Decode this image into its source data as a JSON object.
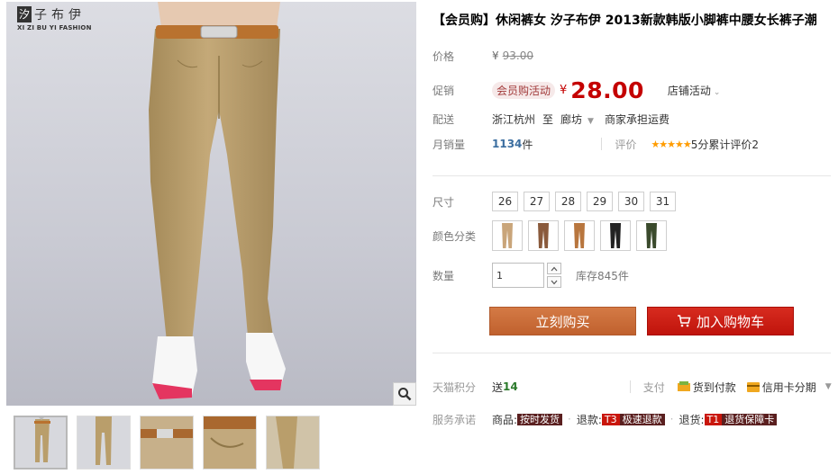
{
  "gallery": {
    "brand_mark": "汐",
    "brand_name": "子布伊",
    "brand_sub": "XI ZI BU YI FASHION",
    "zoom_icon": "magnifier-icon",
    "thumbnails": [
      {
        "pant_color": "#b99e6b",
        "view": "front"
      },
      {
        "pant_color": "#b99e6b",
        "view": "front-full"
      },
      {
        "pant_color": "#b99e6b",
        "view": "waist"
      },
      {
        "pant_color": "#b99e6b",
        "view": "pocket"
      },
      {
        "pant_color": "#b99e6b",
        "view": "side"
      }
    ]
  },
  "product": {
    "title": "【会员购】休闲裤女 汐子布伊 2013新款韩版小脚裤中腰女长裤子潮"
  },
  "price": {
    "label": "价格",
    "yen": "¥",
    "original": "93.00"
  },
  "promo": {
    "label": "促销",
    "badge": "会员购活动",
    "yen": "¥",
    "price": "28.00",
    "shop_promo": "店铺活动",
    "caret": "⌄"
  },
  "shipping": {
    "label": "配送",
    "from": "浙江杭州",
    "to_word": "至",
    "to": "廊坊",
    "caret": "▼",
    "fee": "商家承担运费"
  },
  "sales": {
    "label": "月销量",
    "count": "1134",
    "unit": "件",
    "review_label": "评价",
    "stars": "★★★★★",
    "rating": "5分",
    "total_label": "累计评价",
    "total": "2"
  },
  "size": {
    "label": "尺寸",
    "options": [
      "26",
      "27",
      "28",
      "29",
      "30",
      "31"
    ]
  },
  "color": {
    "label": "颜色分类",
    "options": [
      {
        "color": "#c9a57a"
      },
      {
        "color": "#8a5a3c"
      },
      {
        "color": "#b8763e"
      },
      {
        "color": "#222222"
      },
      {
        "color": "#3a4a2c"
      }
    ]
  },
  "quantity": {
    "label": "数量",
    "value": "1",
    "stock_label": "库存845件"
  },
  "actions": {
    "buy_now": "立刻购买",
    "add_cart": "加入购物车",
    "cart_icon": "cart-icon"
  },
  "points": {
    "label": "天猫积分",
    "send_word": "送",
    "value": "14",
    "pay_label": "支付",
    "cod": "货到付款",
    "credit": "信用卡分期",
    "caret": "▼"
  },
  "service": {
    "label": "服务承诺",
    "items": [
      {
        "prefix": "商品:",
        "tag": "按时发货",
        "style": "dark"
      },
      {
        "prefix": "退款:",
        "code": "T3",
        "tag": "极速退款",
        "style": "dark"
      },
      {
        "prefix": "退货:",
        "code": "T1",
        "tag": "退货保障卡",
        "style": "dark"
      }
    ]
  }
}
